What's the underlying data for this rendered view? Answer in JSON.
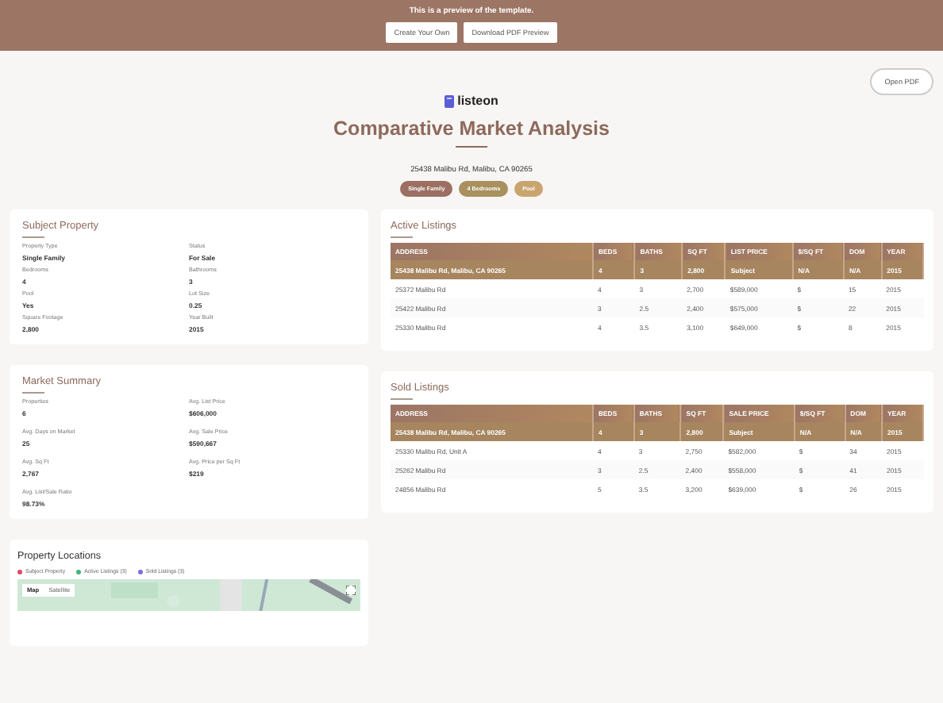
{
  "banner": {
    "message": "This is a preview of the template.",
    "buttons": [
      "Create Your Own",
      "Download PDF Preview"
    ]
  },
  "open_pdf": "Open PDF",
  "logo": "listeon",
  "title": "Comparative Market Analysis",
  "address": "25438 Malibu Rd, Malibu, CA 90265",
  "tags": [
    {
      "label": "Single Family",
      "color": "#9c6f63"
    },
    {
      "label": "4 Bedrooms",
      "color": "#a8915f"
    },
    {
      "label": "Pool",
      "color": "#c9a46e"
    }
  ],
  "subject": {
    "title": "Subject Property",
    "fields": [
      {
        "label": "Property Type",
        "value": "Single Family"
      },
      {
        "label": "Status",
        "value": "For Sale"
      },
      {
        "label": "Bedrooms",
        "value": "4"
      },
      {
        "label": "Bathrooms",
        "value": "3"
      },
      {
        "label": "Pool",
        "value": "Yes"
      },
      {
        "label": "Lot Size",
        "value": "0.25"
      },
      {
        "label": "Square Footage",
        "value": "2,800"
      },
      {
        "label": "Year Built",
        "value": "2015"
      }
    ]
  },
  "summary": {
    "title": "Market Summary",
    "fields": [
      {
        "label": "Properties",
        "value": "6"
      },
      {
        "label": "Avg. List Price",
        "value": "$606,000"
      },
      {
        "label": "Avg. Days on Market",
        "value": "25"
      },
      {
        "label": "Avg. Sale Price",
        "value": "$590,667"
      },
      {
        "label": "Avg. Sq Ft",
        "value": "2,767"
      },
      {
        "label": "Avg. Price per Sq Ft",
        "value": "$219"
      },
      {
        "label": "Avg. List/Sale Ratio",
        "value": "98.73%"
      }
    ]
  },
  "locations": {
    "title": "Property Locations",
    "legend": [
      {
        "label": "Subject Property",
        "color": "#e0486a"
      },
      {
        "label": "Active Listings (3)",
        "color": "#3fb27f"
      },
      {
        "label": "Sold Listings (3)",
        "color": "#7a6ee0"
      }
    ],
    "map_tabs": [
      {
        "label": "Map",
        "selected": true
      },
      {
        "label": "Satellite",
        "selected": false
      }
    ]
  },
  "active": {
    "title": "Active Listings",
    "columns": [
      "ADDRESS",
      "BEDS",
      "BATHS",
      "SQ FT",
      "LIST PRICE",
      "$/SQ FT",
      "DOM",
      "YEAR"
    ],
    "subject_row": [
      "25438 Malibu Rd, Malibu, CA 90265",
      "4",
      "3",
      "2,800",
      "Subject",
      "N/A",
      "N/A",
      "2015"
    ],
    "rows": [
      [
        "25372 Malibu Rd",
        "4",
        "3",
        "2,700",
        "$589,000",
        "$",
        "15",
        "2015"
      ],
      [
        "25422 Malibu Rd",
        "3",
        "2.5",
        "2,400",
        "$575,000",
        "$",
        "22",
        "2015"
      ],
      [
        "25330 Malibu Rd",
        "4",
        "3.5",
        "3,100",
        "$649,000",
        "$",
        "8",
        "2015"
      ]
    ]
  },
  "sold": {
    "title": "Sold Listings",
    "columns": [
      "ADDRESS",
      "BEDS",
      "BATHS",
      "SQ FT",
      "SALE PRICE",
      "$/SQ FT",
      "DOM",
      "YEAR"
    ],
    "subject_row": [
      "25438 Malibu Rd, Malibu, CA 90265",
      "4",
      "3",
      "2,800",
      "Subject",
      "N/A",
      "N/A",
      "2015"
    ],
    "rows": [
      [
        "25330 Malibu Rd, Unit A",
        "4",
        "3",
        "2,750",
        "$582,000",
        "$",
        "34",
        "2015"
      ],
      [
        "25262 Malibu Rd",
        "3",
        "2.5",
        "2,400",
        "$558,000",
        "$",
        "41",
        "2015"
      ],
      [
        "24856 Malibu Rd",
        "5",
        "3.5",
        "3,200",
        "$639,000",
        "$",
        "26",
        "2015"
      ]
    ]
  }
}
